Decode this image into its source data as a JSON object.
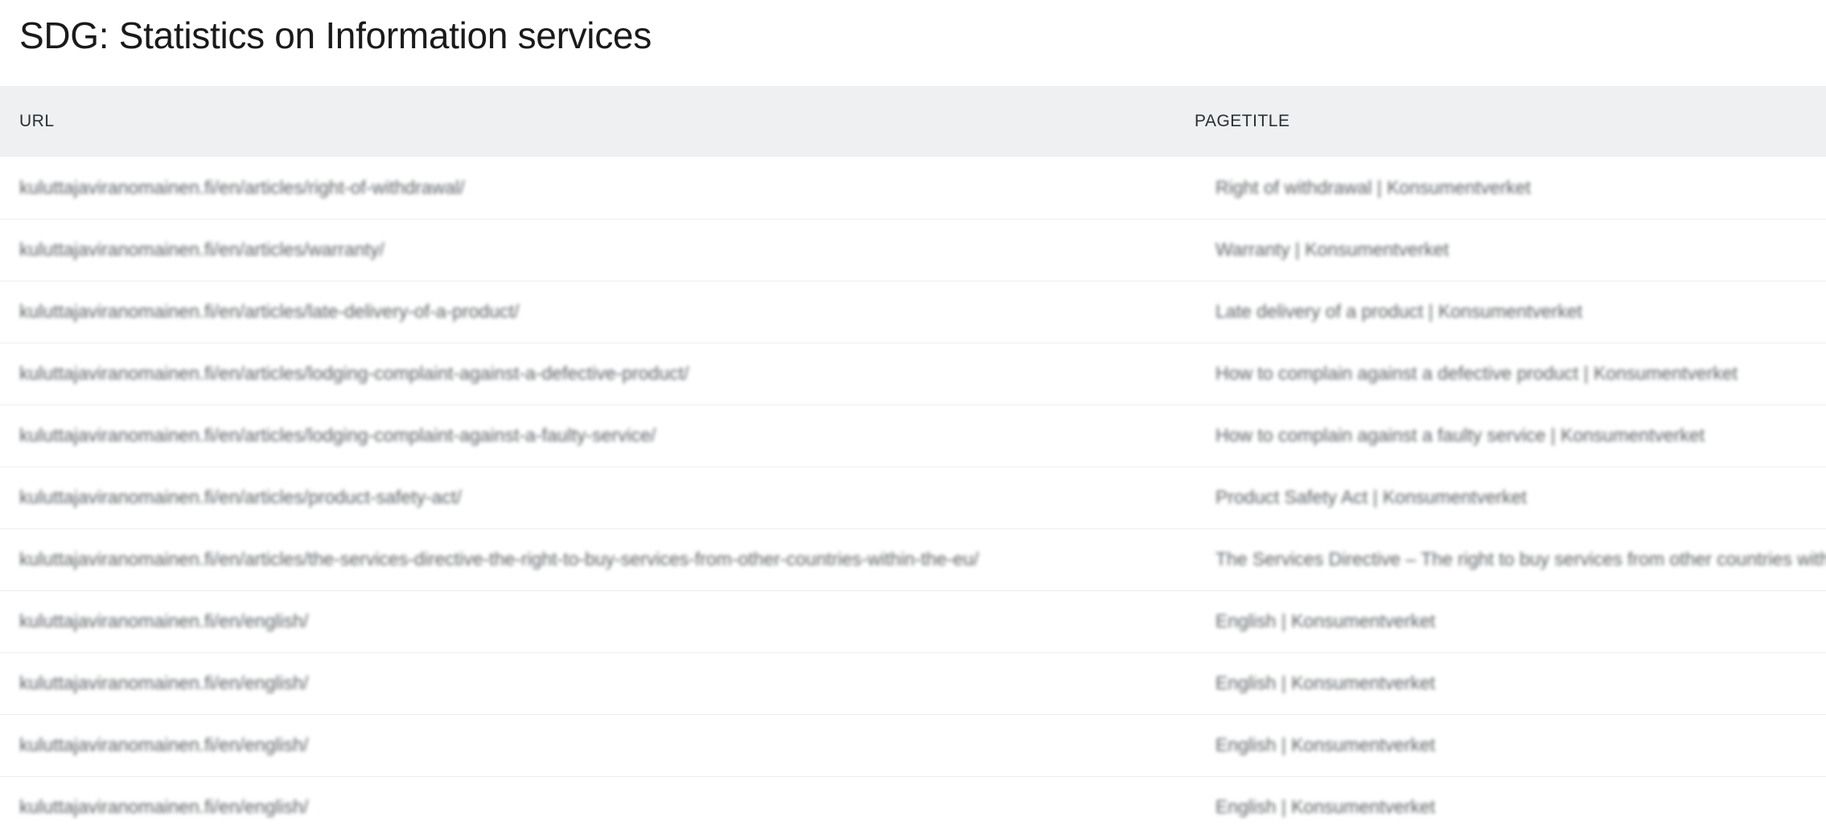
{
  "page": {
    "title": "SDG: Statistics on Information services"
  },
  "table": {
    "columns": {
      "url": "URL",
      "pagetitle": "PAGETITLE"
    },
    "rows": [
      {
        "url": "kuluttajaviranomainen.fi/en/articles/right-of-withdrawal/",
        "title": "Right of withdrawal | Konsumentverket"
      },
      {
        "url": "kuluttajaviranomainen.fi/en/articles/warranty/",
        "title": "Warranty | Konsumentverket"
      },
      {
        "url": "kuluttajaviranomainen.fi/en/articles/late-delivery-of-a-product/",
        "title": "Late delivery of a product | Konsumentverket"
      },
      {
        "url": "kuluttajaviranomainen.fi/en/articles/lodging-complaint-against-a-defective-product/",
        "title": "How to complain against a defective product | Konsumentverket"
      },
      {
        "url": "kuluttajaviranomainen.fi/en/articles/lodging-complaint-against-a-faulty-service/",
        "title": "How to complain against a faulty service | Konsumentverket"
      },
      {
        "url": "kuluttajaviranomainen.fi/en/articles/product-safety-act/",
        "title": "Product Safety Act | Konsumentverket"
      },
      {
        "url": "kuluttajaviranomainen.fi/en/articles/the-services-directive-the-right-to-buy-services-from-other-countries-within-the-eu/",
        "title": "The Services Directive – The right to buy services from other countries within the EU"
      },
      {
        "url": "kuluttajaviranomainen.fi/en/english/",
        "title": "English | Konsumentverket"
      },
      {
        "url": "kuluttajaviranomainen.fi/en/english/",
        "title": "English | Konsumentverket"
      },
      {
        "url": "kuluttajaviranomainen.fi/en/english/",
        "title": "English | Konsumentverket"
      },
      {
        "url": "kuluttajaviranomainen.fi/en/english/",
        "title": "English | Konsumentverket"
      }
    ]
  }
}
